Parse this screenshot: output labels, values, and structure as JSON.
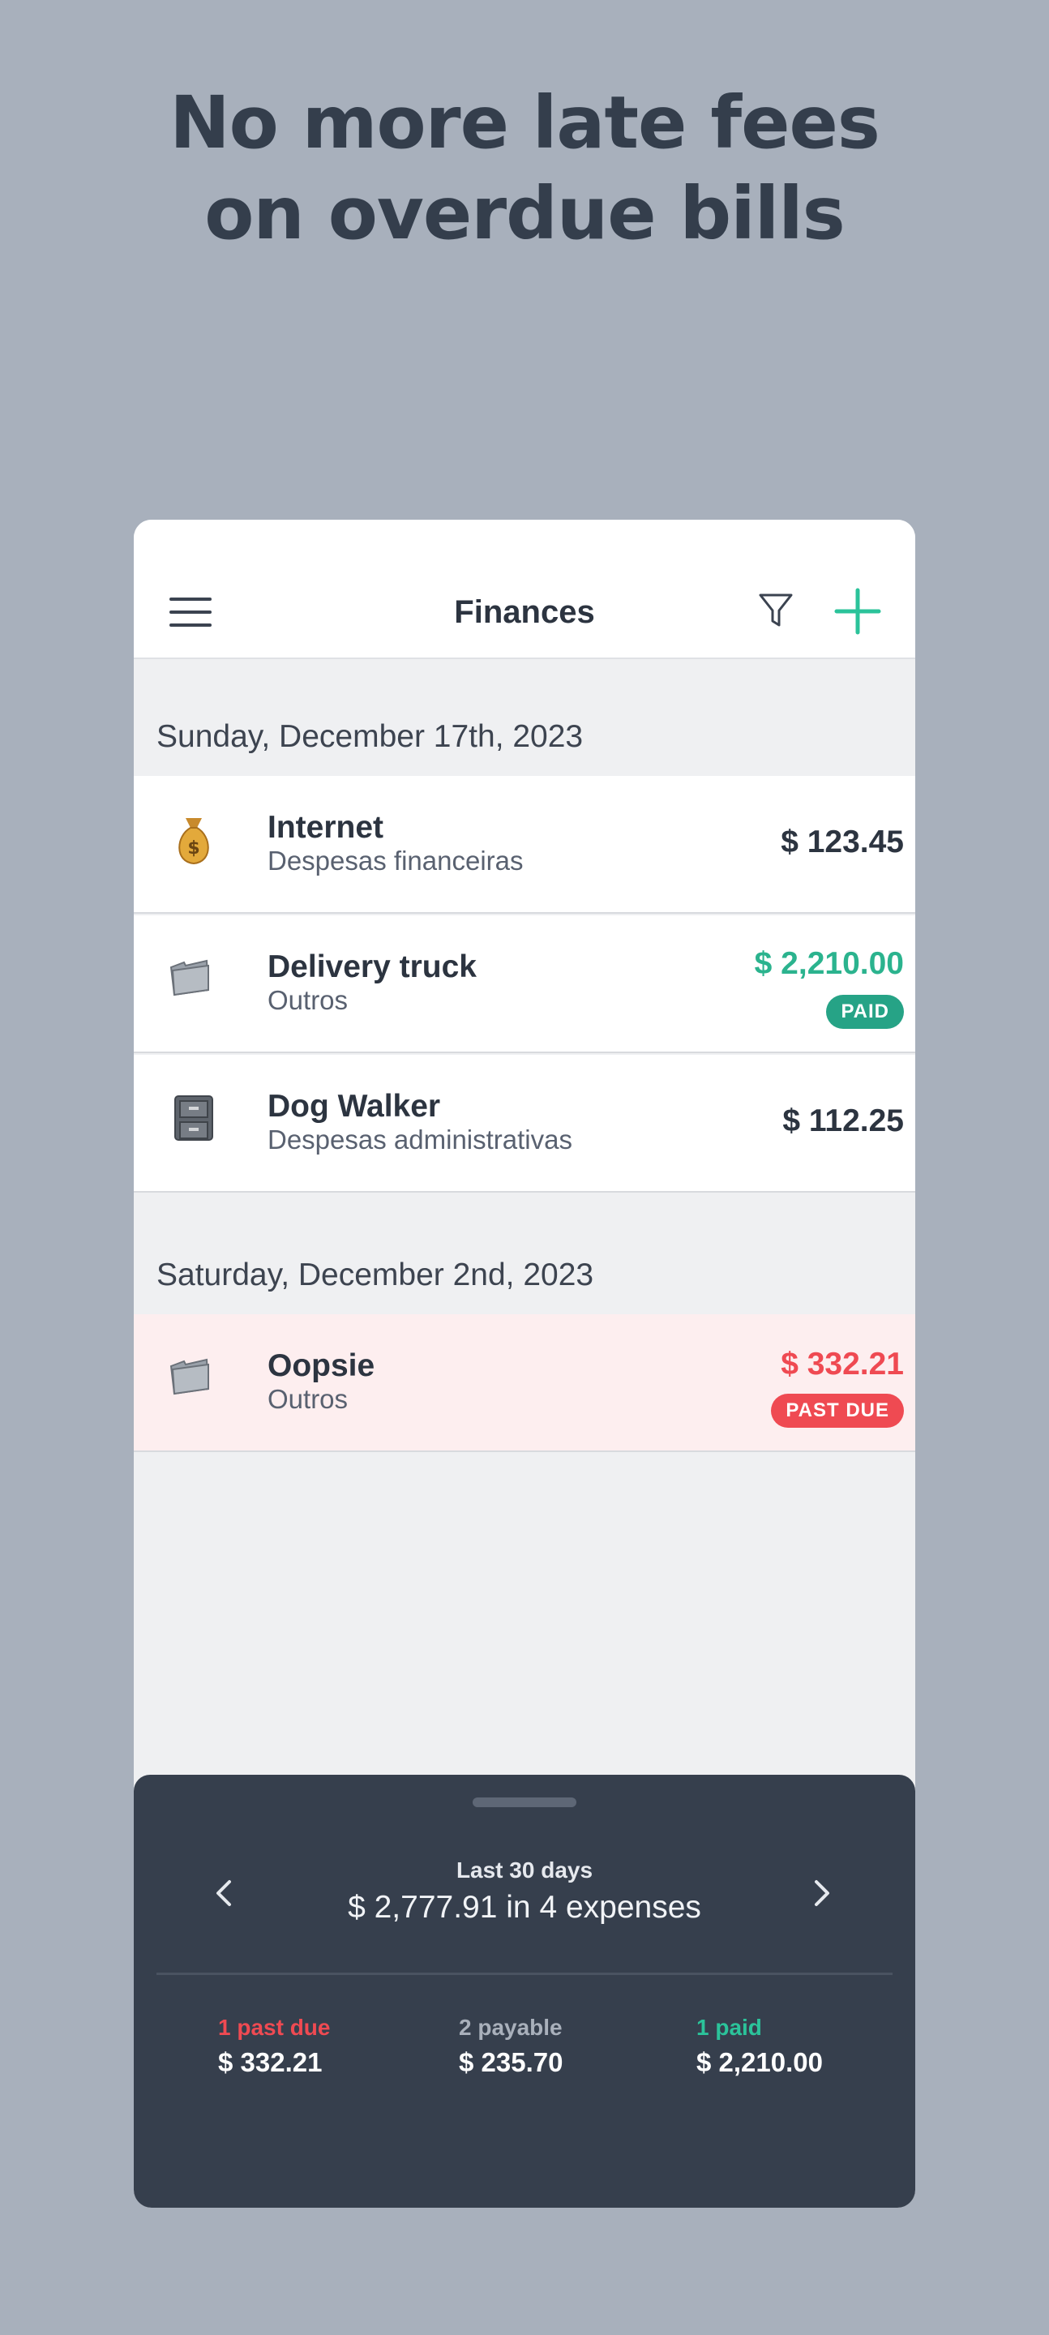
{
  "headline": {
    "line1": "No more late fees",
    "line2": "on overdue bills"
  },
  "app": {
    "title": "Finances",
    "icons": [
      "menu-icon",
      "filter-icon",
      "add-icon"
    ]
  },
  "groups": [
    {
      "date": "Sunday, December 17th, 2023",
      "items": [
        {
          "name": "Internet",
          "category": "Despesas financeiras",
          "amount": "$ 123.45",
          "status": "",
          "icon": "money-bag-icon"
        },
        {
          "name": "Delivery truck",
          "category": "Outros",
          "amount": "$ 2,210.00",
          "status": "PAID",
          "icon": "folder-icon"
        },
        {
          "name": "Dog Walker",
          "category": "Despesas administrativas",
          "amount": "$ 112.25",
          "status": "",
          "icon": "file-cabinet-icon"
        }
      ]
    },
    {
      "date": "Saturday, December 2nd, 2023",
      "items": [
        {
          "name": "Oopsie",
          "category": "Outros",
          "amount": "$ 332.21",
          "status": "PAST DUE",
          "icon": "folder-icon"
        }
      ]
    }
  ],
  "summary": {
    "period": "Last 30 days",
    "total": "$ 2,777.91 in 4 expenses",
    "stats": [
      {
        "label": "1 past due",
        "value": "$ 332.21",
        "color": "#ef4a52"
      },
      {
        "label": "2 payable",
        "value": "$ 235.70",
        "color": "#a9b0bb"
      },
      {
        "label": "1 paid",
        "value": "$ 2,210.00",
        "color": "#2bc39a"
      }
    ]
  },
  "colors": {
    "background": "#a8b0bc",
    "paid": "#26a386",
    "past_due": "#ef4a52",
    "sheet": "#363f4d",
    "accent": "#2bc39a"
  }
}
